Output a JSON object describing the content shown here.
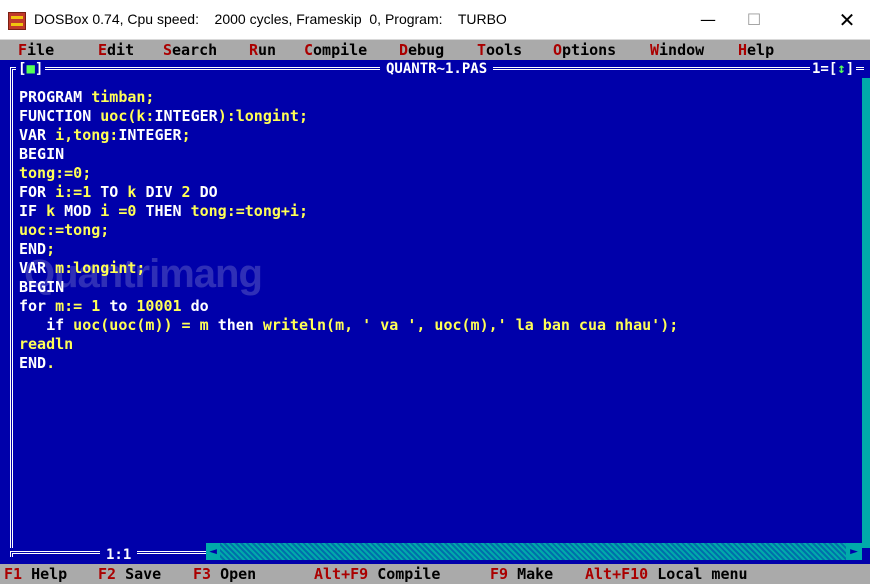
{
  "window": {
    "title": "DOSBox 0.74, Cpu speed:    2000 cycles, Frameskip  0, Program:    TURBO",
    "minimize": "—",
    "maximize": "☐",
    "close": "✕"
  },
  "menu": [
    {
      "hot": "F",
      "rest": "ile"
    },
    {
      "hot": "E",
      "rest": "dit"
    },
    {
      "hot": "S",
      "rest": "earch"
    },
    {
      "hot": "R",
      "rest": "un"
    },
    {
      "hot": "C",
      "rest": "ompile"
    },
    {
      "hot": "D",
      "rest": "ebug"
    },
    {
      "hot": "T",
      "rest": "ools"
    },
    {
      "hot": "O",
      "rest": "ptions"
    },
    {
      "hot": "W",
      "rest": "indow"
    },
    {
      "hot": "H",
      "rest": "elp"
    }
  ],
  "editor": {
    "close_box_left": "[",
    "close_box_mark": "■",
    "close_box_right": "]",
    "filename": "QUANTR~1.PAS",
    "window_number": "1=[",
    "zoom_mark": "↕",
    "window_number_end": "]",
    "cursor_position": "1:1",
    "lines": [
      [
        {
          "k": "PROGRAM"
        },
        {
          "t": " timban;"
        }
      ],
      [
        {
          "k": "FUNCTION"
        },
        {
          "t": " uoc(k:"
        },
        {
          "k": "INTEGER"
        },
        {
          "t": "):longint;"
        }
      ],
      [
        {
          "k": "VAR"
        },
        {
          "t": " i,tong:"
        },
        {
          "k": "INTEGER"
        },
        {
          "t": ";"
        }
      ],
      [
        {
          "k": "BEGIN"
        }
      ],
      [
        {
          "t": "tong:=0;"
        }
      ],
      [
        {
          "k": "FOR"
        },
        {
          "t": " i:=1 "
        },
        {
          "k": "TO"
        },
        {
          "t": " k "
        },
        {
          "k": "DIV"
        },
        {
          "t": " 2 "
        },
        {
          "k": "DO"
        }
      ],
      [
        {
          "k": "IF"
        },
        {
          "t": " k "
        },
        {
          "k": "MOD"
        },
        {
          "t": " i =0 "
        },
        {
          "k": "THEN"
        },
        {
          "t": " tong:=tong+i;"
        }
      ],
      [
        {
          "t": "uoc:=tong;"
        }
      ],
      [
        {
          "k": "END"
        },
        {
          "t": ";"
        }
      ],
      [
        {
          "k": "VAR"
        },
        {
          "t": " m:longint;"
        }
      ],
      [
        {
          "k": "BEGIN"
        }
      ],
      [
        {
          "k": "for"
        },
        {
          "t": " m:= 1 "
        },
        {
          "k": "to"
        },
        {
          "t": " 10001 "
        },
        {
          "k": "do"
        }
      ],
      [
        {
          "t": "   "
        },
        {
          "k": "if"
        },
        {
          "t": " uoc(uoc(m)) = m "
        },
        {
          "k": "then"
        },
        {
          "t": " writeln(m, ' va ', uoc(m),' la ban cua nhau');"
        }
      ],
      [
        {
          "t": "readln"
        }
      ],
      [
        {
          "k": "END"
        },
        {
          "t": "."
        }
      ]
    ]
  },
  "watermark": "Quantrimang",
  "status": [
    {
      "key": "F1",
      "label": " Help"
    },
    {
      "key": "F2",
      "label": " Save"
    },
    {
      "key": "F3",
      "label": " Open"
    },
    {
      "key": "Alt+F9",
      "label": " Compile"
    },
    {
      "key": "F9",
      "label": " Make"
    },
    {
      "key": "Alt+F10",
      "label": " Local menu"
    }
  ]
}
